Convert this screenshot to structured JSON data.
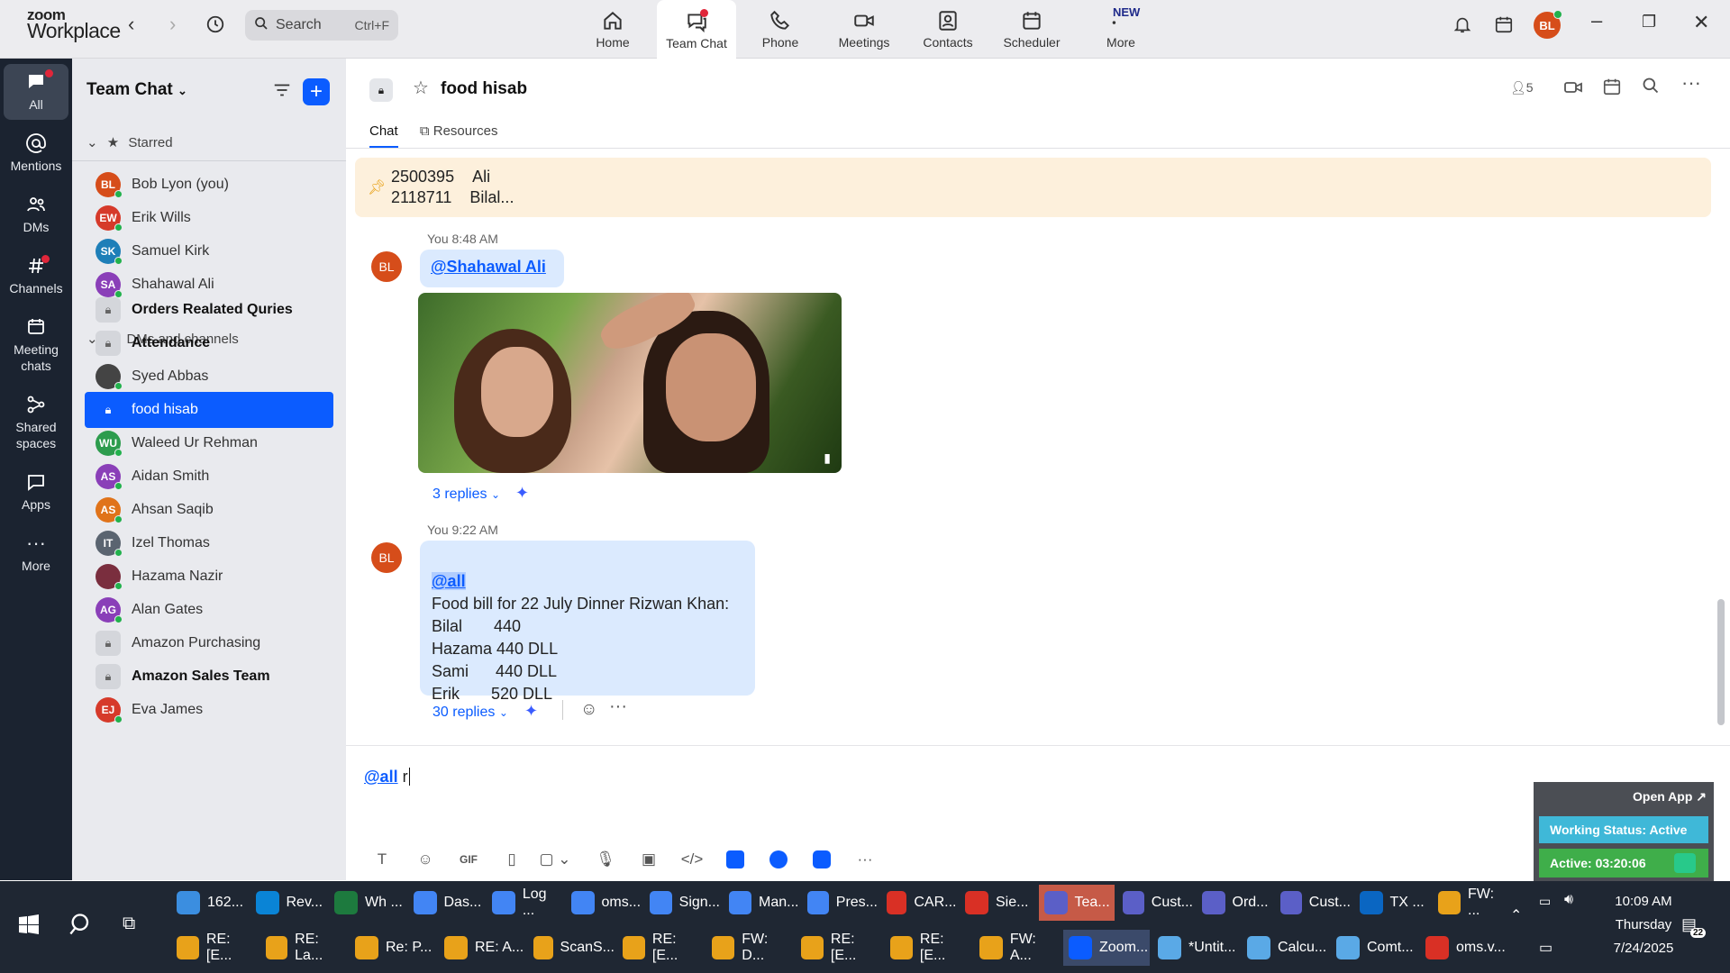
{
  "app": {
    "logo_line1": "zoom",
    "logo_line2": "Workplace"
  },
  "topbar": {
    "search_label": "Search",
    "search_shortcut": "Ctrl+F",
    "nav": [
      "Home",
      "Team Chat",
      "Phone",
      "Meetings",
      "Contacts",
      "Scheduler",
      "More"
    ],
    "new_badge": "NEW",
    "user_initials": "BL"
  },
  "rail": {
    "items": [
      "All",
      "Mentions",
      "DMs",
      "Channels",
      "Meeting chats",
      "Shared spaces",
      "Apps",
      "More"
    ]
  },
  "sidebar": {
    "title": "Team Chat",
    "starred_label": "Starred",
    "dms_label": "DMs and channels",
    "starred": [
      {
        "name": "Bob Lyon (you)",
        "initials": "BL",
        "color": "#d64d1a"
      },
      {
        "name": "Erik Wills",
        "initials": "EW",
        "color": "#d63a2a"
      },
      {
        "name": "Samuel Kirk",
        "initials": "SK",
        "color": "#1e7fb8"
      },
      {
        "name": "Shahawal Ali",
        "initials": "SA",
        "color": "#8a3fb8"
      }
    ],
    "channels": [
      {
        "name": "Orders Realated Quries",
        "type": "lock",
        "bold": true
      },
      {
        "name": "Attendance",
        "type": "lock",
        "bold": true
      },
      {
        "name": "Syed Abbas",
        "type": "photo",
        "initials": "",
        "color": "#444"
      },
      {
        "name": "food hisab",
        "type": "lock",
        "selected": true
      },
      {
        "name": "Waleed Ur Rehman",
        "initials": "WU",
        "color": "#2d9c4d"
      },
      {
        "name": "Aidan Smith",
        "initials": "AS",
        "color": "#8a3fb8"
      },
      {
        "name": "Ahsan Saqib",
        "initials": "AS",
        "color": "#e0731a"
      },
      {
        "name": "Izel Thomas",
        "initials": "IT",
        "color": "#5a6470"
      },
      {
        "name": "Hazama Nazir",
        "initials": "",
        "color": "#7a2e3e"
      },
      {
        "name": "Alan Gates",
        "initials": "AG",
        "color": "#8a3fb8"
      },
      {
        "name": "Amazon Purchasing",
        "type": "lock"
      },
      {
        "name": "Amazon Sales Team",
        "type": "lock",
        "bold": true
      },
      {
        "name": "Eva James",
        "initials": "EJ",
        "color": "#d63a2a"
      }
    ]
  },
  "channel": {
    "title": "food hisab",
    "member_count": "5",
    "tabs": [
      "Chat",
      "Resources"
    ],
    "pinned": [
      {
        "id": "2500395",
        "name": "Ali"
      },
      {
        "id": "2118711",
        "name": "Bilal..."
      }
    ]
  },
  "messages": [
    {
      "author": "You",
      "time": "8:48 AM",
      "initials": "BL",
      "mention": "@Shahawal Ali",
      "replies": "3 replies"
    },
    {
      "author": "You",
      "time": "9:22 AM",
      "initials": "BL",
      "mention": "@all",
      "lines": [
        "Food bill for 22 July Dinner Rizwan Khan:",
        "Bilal       440",
        "Hazama 440 DLL",
        "Sami      440 DLL",
        "Erik       520 DLL"
      ],
      "replies": "30 replies"
    }
  ],
  "composer": {
    "mention": "@all",
    "text": "r"
  },
  "widget": {
    "open_app": "Open App ↗",
    "status": "Working Status: Active",
    "timer": "Active: 03:20:06"
  },
  "taskbar": {
    "row1": [
      "162...",
      "Rev...",
      "Wh ...",
      "Das...",
      "Log ...",
      "oms...",
      "Sign...",
      "Man...",
      "Pres...",
      "CAR...",
      "Sie...",
      "Tea...",
      "Cust...",
      "Ord...",
      "Cust...",
      "TX ...",
      "FW: ..."
    ],
    "row2": [
      "RE: [E...",
      "RE: La...",
      "Re: P...",
      "RE: A...",
      "ScanS...",
      "RE: [E...",
      "FW: D...",
      "RE: [E...",
      "RE: [E...",
      "FW: A...",
      "Zoom...",
      "*Untit...",
      "Calcu...",
      "Comt...",
      "oms.v..."
    ],
    "time": "10:09 AM",
    "day": "Thursday",
    "date": "7/24/2025",
    "notif_count": "22"
  }
}
